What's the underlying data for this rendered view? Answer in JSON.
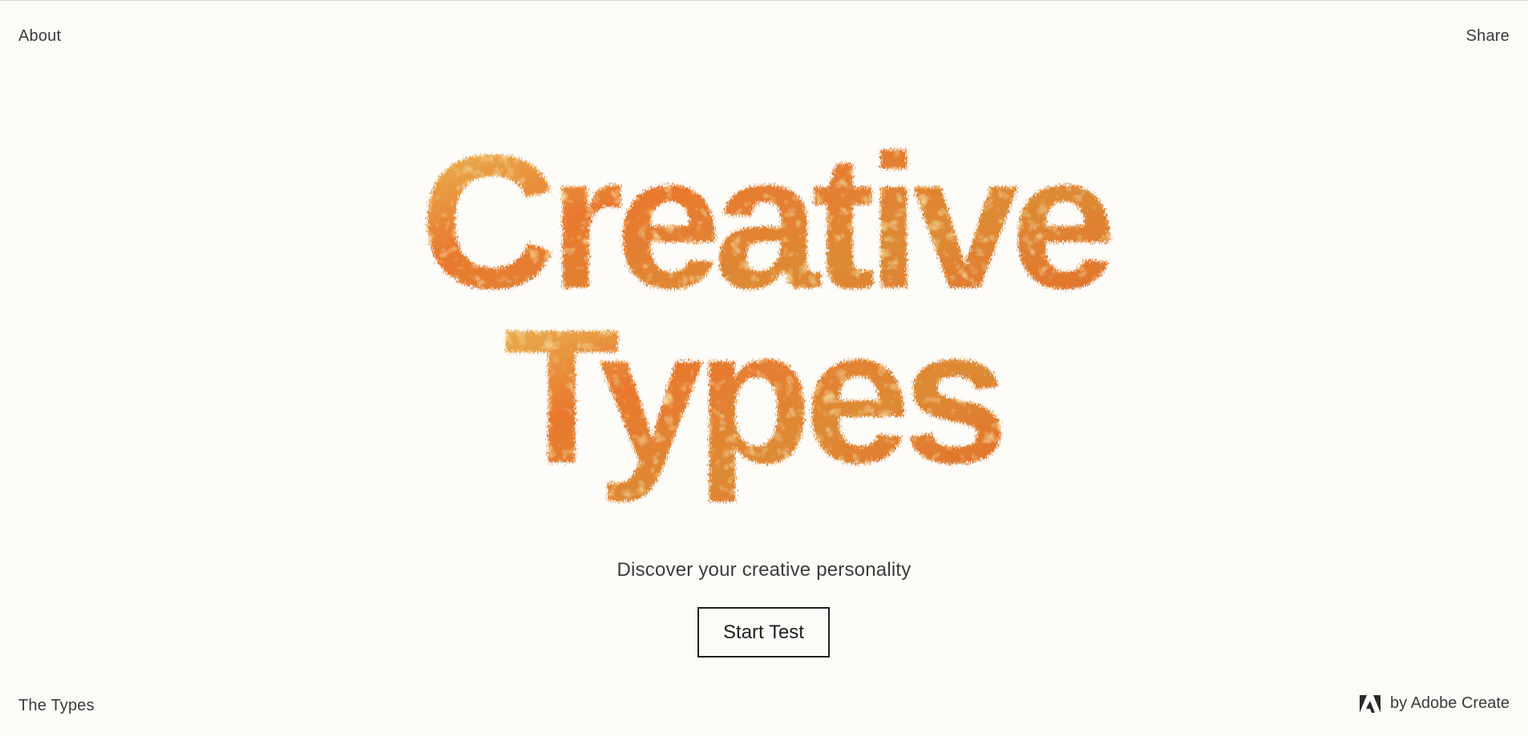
{
  "header": {
    "about_label": "About",
    "share_label": "Share"
  },
  "hero": {
    "title_line1": "Creative",
    "title_line2": "Types",
    "fur_colors": [
      "#e8742c",
      "#d9a23a",
      "#f0b64a",
      "#8fb59a"
    ]
  },
  "main": {
    "tagline": "Discover your creative personality",
    "start_button_label": "Start Test"
  },
  "footer": {
    "types_label": "The Types",
    "byline": "by Adobe Create",
    "logo_icon": "adobe-logo-icon"
  }
}
